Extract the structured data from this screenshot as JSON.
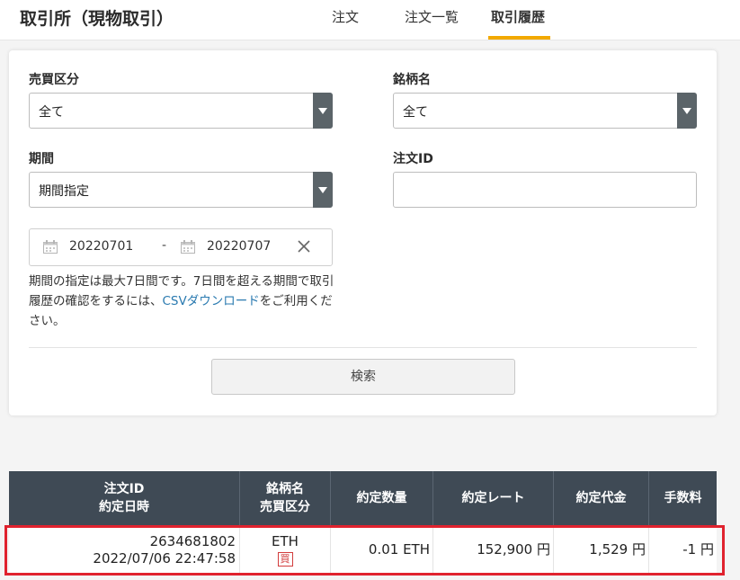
{
  "header": {
    "title": "取引所（現物取引）",
    "tabs": [
      {
        "label": "注文",
        "active": false
      },
      {
        "label": "注文一覧",
        "active": false
      },
      {
        "label": "取引履歴",
        "active": true
      }
    ],
    "accent_color": "#f2a900"
  },
  "filters": {
    "trade_type": {
      "label": "売買区分",
      "value": "全て"
    },
    "symbol": {
      "label": "銘柄名",
      "value": "全て"
    },
    "period": {
      "label": "期間",
      "value": "期間指定"
    },
    "order_id": {
      "label": "注文ID",
      "value": "",
      "placeholder": ""
    },
    "date_from": "20220701",
    "date_to": "20220707",
    "date_separator": "-",
    "note_prefix": "期間の指定は最大7日間です。7日間を超える期間で取引履歴の確認をするには、",
    "note_link": "CSVダウンロード",
    "note_suffix": "をご利用ください。",
    "search_button": "検索"
  },
  "table": {
    "headers": {
      "order_id_line1": "注文ID",
      "order_id_line2": "約定日時",
      "symbol_line1": "銘柄名",
      "symbol_line2": "売買区分",
      "quantity": "約定数量",
      "rate": "約定レート",
      "amount": "約定代金",
      "fee": "手数料"
    },
    "rows": [
      {
        "order_id": "2634681802",
        "datetime": "2022/07/06 22:47:58",
        "symbol": "ETH",
        "side": "買",
        "quantity": "0.01 ETH",
        "rate": "152,900 円",
        "amount": "1,529 円",
        "fee": "-1 円"
      }
    ],
    "highlight_color": "#e0222e"
  }
}
